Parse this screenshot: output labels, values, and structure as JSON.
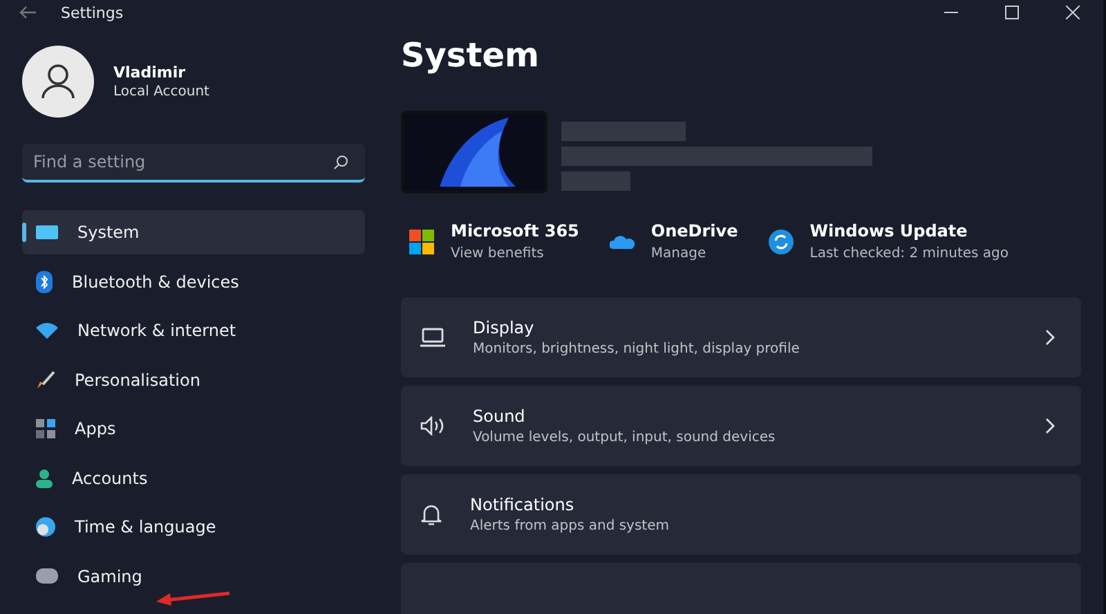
{
  "window": {
    "title": "Settings"
  },
  "account": {
    "name": "Vladimir",
    "type": "Local Account"
  },
  "search": {
    "placeholder": "Find a setting"
  },
  "sidebar": {
    "items": [
      {
        "label": "System",
        "selected": true
      },
      {
        "label": "Bluetooth & devices",
        "selected": false
      },
      {
        "label": "Network & internet",
        "selected": false
      },
      {
        "label": "Personalisation",
        "selected": false
      },
      {
        "label": "Apps",
        "selected": false
      },
      {
        "label": "Accounts",
        "selected": false
      },
      {
        "label": "Time & language",
        "selected": false
      },
      {
        "label": "Gaming",
        "selected": false
      }
    ]
  },
  "page": {
    "title": "System"
  },
  "quick_links": [
    {
      "title": "Microsoft 365",
      "subtitle": "View benefits"
    },
    {
      "title": "OneDrive",
      "subtitle": "Manage"
    },
    {
      "title": "Windows Update",
      "subtitle": "Last checked: 2 minutes ago"
    }
  ],
  "settings": [
    {
      "title": "Display",
      "description": "Monitors, brightness, night light, display profile",
      "chevron": true
    },
    {
      "title": "Sound",
      "description": "Volume levels, output, input, sound devices",
      "chevron": true
    },
    {
      "title": "Notifications",
      "description": "Alerts from apps and system",
      "chevron": false
    }
  ]
}
